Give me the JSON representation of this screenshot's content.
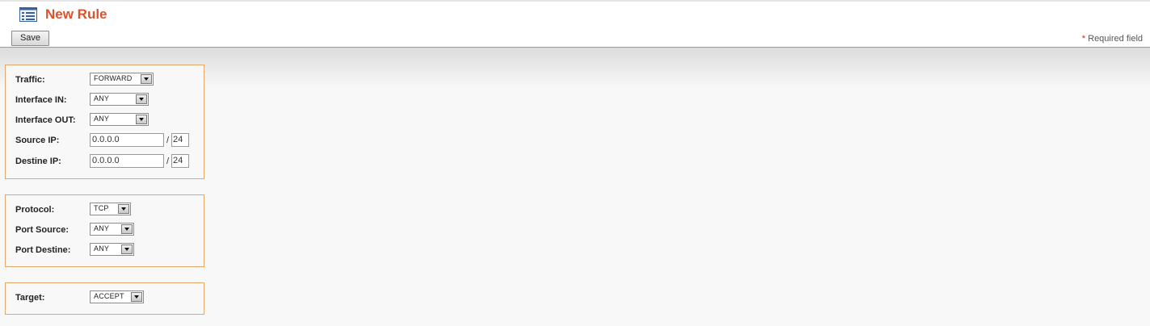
{
  "header": {
    "title": "New Rule",
    "save_label": "Save",
    "required_star": "*",
    "required_text": "Required field"
  },
  "network": {
    "traffic": {
      "label": "Traffic:",
      "value": "FORWARD"
    },
    "interface_in": {
      "label": "Interface IN:",
      "value": "ANY"
    },
    "interface_out": {
      "label": "Interface OUT:",
      "value": "ANY"
    },
    "source_ip": {
      "label": "Source IP:",
      "value": "0.0.0.0",
      "separator": "/",
      "mask": "24"
    },
    "destine_ip": {
      "label": "Destine IP:",
      "value": "0.0.0.0",
      "separator": "/",
      "mask": "24"
    }
  },
  "ports": {
    "protocol": {
      "label": "Protocol:",
      "value": "TCP"
    },
    "port_source": {
      "label": "Port Source:",
      "value": "ANY"
    },
    "port_destine": {
      "label": "Port Destine:",
      "value": "ANY"
    }
  },
  "action": {
    "target": {
      "label": "Target:",
      "value": "ACCEPT"
    }
  },
  "colors": {
    "title": "#d9532c",
    "fieldset_border": "#e3a86a",
    "required_star": "#cc2222"
  }
}
